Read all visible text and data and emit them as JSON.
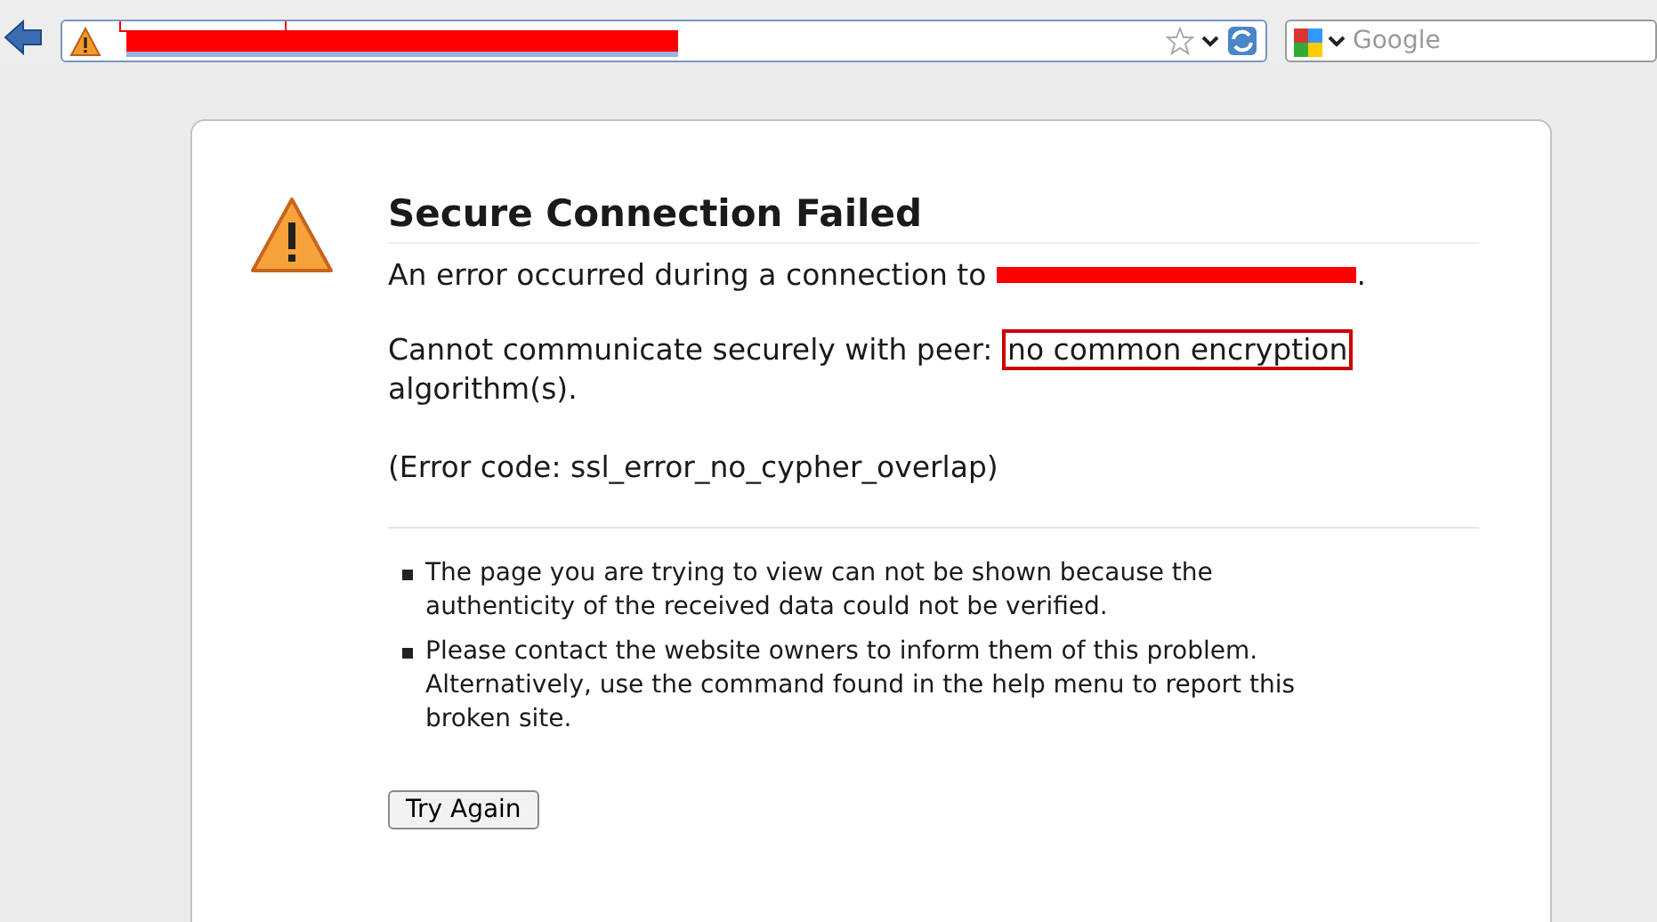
{
  "toolbar": {
    "search": {
      "placeholder": "Google"
    }
  },
  "error": {
    "title": "Secure Connection Failed",
    "intro": "An error occurred during a connection to",
    "intro_end": ".",
    "detail_start": "Cannot communicate securely with peer:",
    "detail_highlight": "no common encryption",
    "detail_end": "algorithm(s).",
    "code": "(Error code: ssl_error_no_cypher_overlap)",
    "bullets": [
      "The page you are trying to view can not be shown because the authenticity of the received data could not be verified.",
      "Please contact the website owners to inform them of this problem. Alternatively, use the command found in the help menu to report this broken site."
    ],
    "button": "Try Again"
  }
}
